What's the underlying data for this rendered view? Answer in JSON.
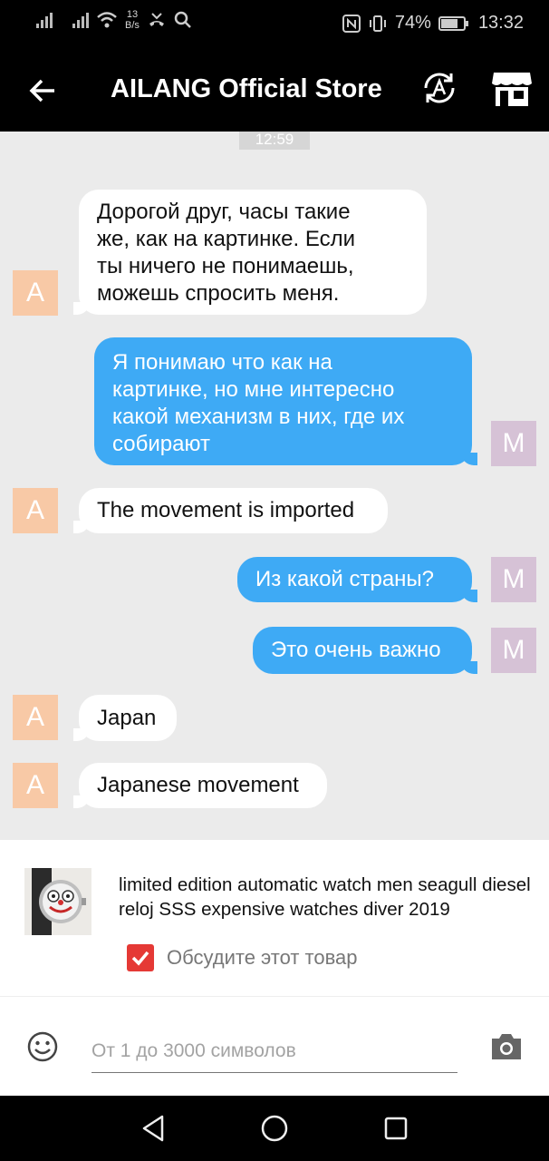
{
  "status_bar": {
    "network_speed_value": "13",
    "network_speed_unit": "B/s",
    "battery": "74%",
    "battery_level": 0.74,
    "time": "13:32"
  },
  "header": {
    "title": "AILANG Official Store",
    "icons": [
      "back-arrow-icon",
      "translate-icon",
      "store-icon"
    ]
  },
  "chat": {
    "timestamp": "12:59",
    "seller_avatar": "A",
    "buyer_avatar": "M",
    "colors": {
      "seller_avatar": "#f8c9a6",
      "buyer_avatar": "#d6c2d6",
      "outgoing_bubble": "#3eaaf5",
      "incoming_bubble": "#ffffff"
    },
    "messages": [
      {
        "from": "seller",
        "text": "Дорогой друг, часы такие\nже, как на картинке. Если\nты ничего не понимаешь,\nможешь спросить меня."
      },
      {
        "from": "buyer",
        "text": "Я понимаю что как на\nкартинке, но мне интересно\nкакой механизм в них, где их\nсобирают"
      },
      {
        "from": "seller",
        "text": "The movement is imported"
      },
      {
        "from": "buyer",
        "text": "Из какой страны?"
      },
      {
        "from": "buyer",
        "text": "Это очень важно"
      },
      {
        "from": "seller",
        "text": "Japan"
      },
      {
        "from": "seller",
        "text": "Japanese movement"
      }
    ]
  },
  "product": {
    "title": "limited edition automatic watch men seagull diesel reloj SSS expensive watches diver 2019",
    "discuss_label": "Обсудите этот товар",
    "discuss_checked": true
  },
  "input": {
    "placeholder": "От 1 до 3000 символов",
    "value": ""
  },
  "nav": {
    "icons": [
      "back-triangle-icon",
      "home-circle-icon",
      "recents-square-icon"
    ]
  }
}
